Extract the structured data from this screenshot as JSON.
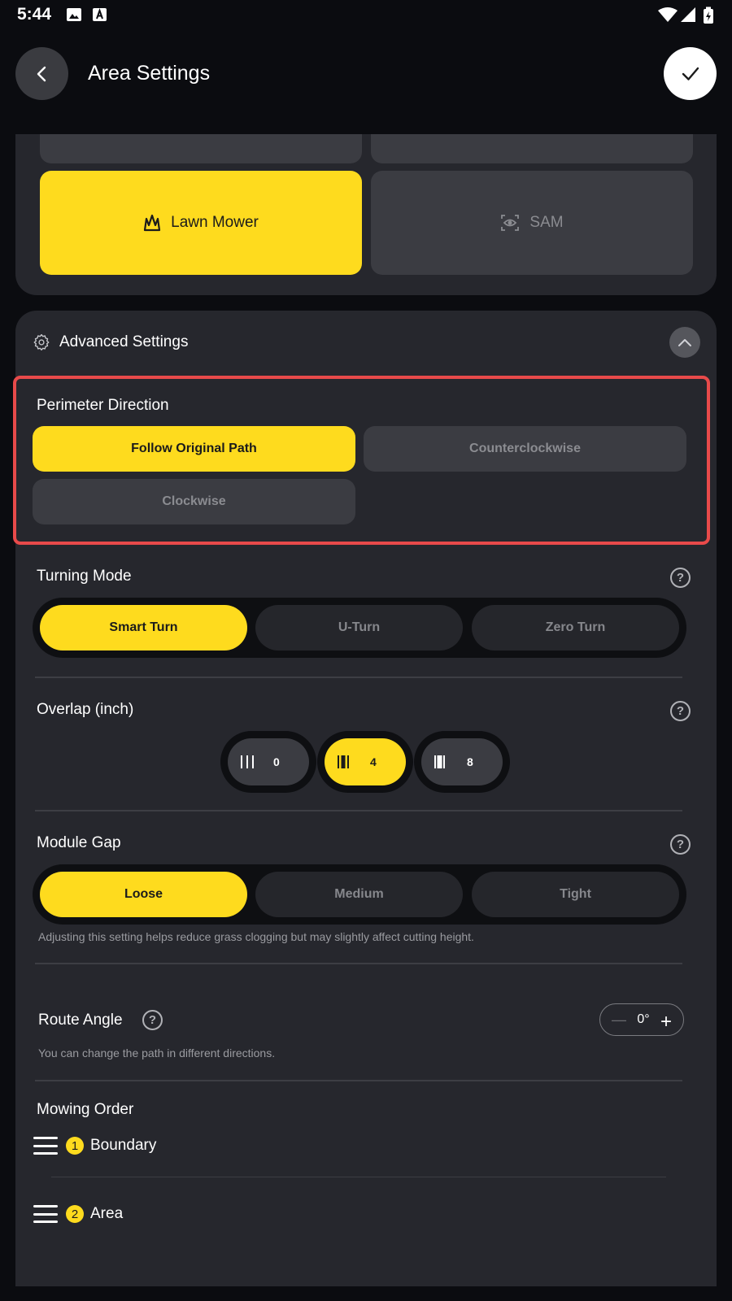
{
  "status_bar": {
    "time": "5:44"
  },
  "header": {
    "title": "Area Settings"
  },
  "mower_types": [
    {
      "label": "Lawn Mower",
      "selected": true,
      "icon": "grass-icon"
    },
    {
      "label": "SAM",
      "selected": false,
      "icon": "eye-scan-icon"
    }
  ],
  "advanced": {
    "title": "Advanced Settings"
  },
  "perimeter": {
    "title": "Perimeter Direction",
    "options": [
      "Follow Original Path",
      "Counterclockwise",
      "Clockwise"
    ],
    "selected": "Follow Original Path"
  },
  "turning": {
    "title": "Turning Mode",
    "options": [
      "Smart Turn",
      "U-Turn",
      "Zero Turn"
    ],
    "selected": "Smart Turn"
  },
  "overlap": {
    "title": "Overlap (inch)",
    "options": [
      "0",
      "4",
      "8"
    ],
    "selected": "4"
  },
  "module_gap": {
    "title": "Module Gap",
    "options": [
      "Loose",
      "Medium",
      "Tight"
    ],
    "selected": "Loose",
    "note": "Adjusting this setting helps reduce grass clogging but may slightly affect cutting height."
  },
  "route_angle": {
    "title": "Route Angle",
    "value": "0°",
    "minus": "—",
    "plus": "+",
    "note": "You can change the path in different directions."
  },
  "mowing_order": {
    "title": "Mowing Order",
    "items": [
      {
        "index": "1",
        "label": "Boundary"
      },
      {
        "index": "2",
        "label": "Area"
      }
    ]
  },
  "help_glyph": "?",
  "colors": {
    "accent": "#fedb1e",
    "background": "#0b0c10",
    "card": "#26272d",
    "highlight": "#e84a4a"
  }
}
